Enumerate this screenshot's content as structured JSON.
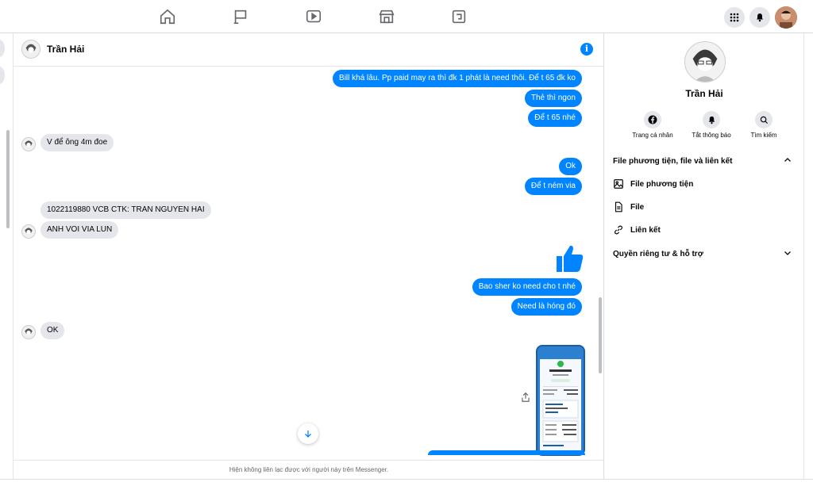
{
  "chat": {
    "contact_name": "Trần Hải",
    "messages_out": [
      "Bill khá lâu. Pp paid may ra thì đk 1 phát là need thôi. Để t 65 đk ko",
      "Thẻ thì ngon",
      "Để t 65 nhé",
      "Ok",
      "Để t ném via",
      "Bao sher ko need cho t nhé",
      "Need là hóng đó"
    ],
    "messages_in": [
      "V để ông 4m đoe",
      "1022119880 VCB CTK: TRAN NGUYEN HAI",
      "ANH VOI VIA LUN",
      "OK"
    ],
    "footer_note": "Hiện không liên lạc được với người này trên Messenger."
  },
  "right_panel": {
    "name": "Trần Hải",
    "actions": [
      {
        "label": "Trang cá nhân",
        "icon": "facebook-icon"
      },
      {
        "label": "Tắt thông báo",
        "icon": "bell-icon"
      },
      {
        "label": "Tìm kiếm",
        "icon": "search-icon"
      }
    ],
    "section_media": "File phương tiện, file và liên kết",
    "media_items": [
      {
        "label": "File phương tiện",
        "icon": "media-icon"
      },
      {
        "label": "File",
        "icon": "file-icon"
      },
      {
        "label": "Liên kết",
        "icon": "link-icon"
      }
    ],
    "section_privacy": "Quyền riêng tư & hỗ trợ"
  },
  "colors": {
    "accent": "#0084ff",
    "bubble_in": "#e4e6eb",
    "icon_gray": "#65676b"
  }
}
